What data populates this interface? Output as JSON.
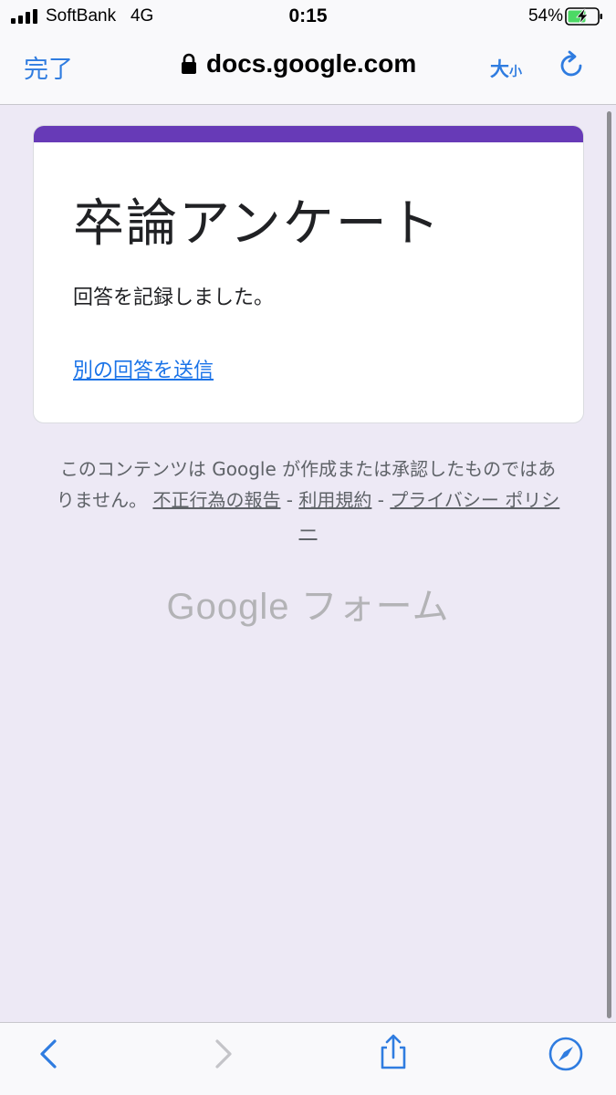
{
  "status_bar": {
    "carrier": "SoftBank",
    "network": "4G",
    "time": "0:15",
    "battery": "54%"
  },
  "browser": {
    "done_label": "完了",
    "url": "docs.google.com",
    "text_size_big": "大",
    "text_size_small": "小",
    "accent_color": "#2f7ce0"
  },
  "form": {
    "title": "卒論アンケート",
    "confirmation": "回答を記録しました。",
    "another_response_link": "別の回答を送信",
    "header_color": "#673ab7"
  },
  "footer": {
    "disclaimer_text": "このコンテンツは Google が作成または承認したものではありません。",
    "report_abuse": "不正行為の報告",
    "terms": "利用規約",
    "privacy": "プライバシー ポリシー",
    "separator": " - ",
    "brand_google": "Google",
    "brand_forms": "フォーム"
  },
  "toolbar": {
    "icons": [
      "back-icon",
      "forward-icon",
      "share-icon",
      "compass-icon"
    ]
  }
}
